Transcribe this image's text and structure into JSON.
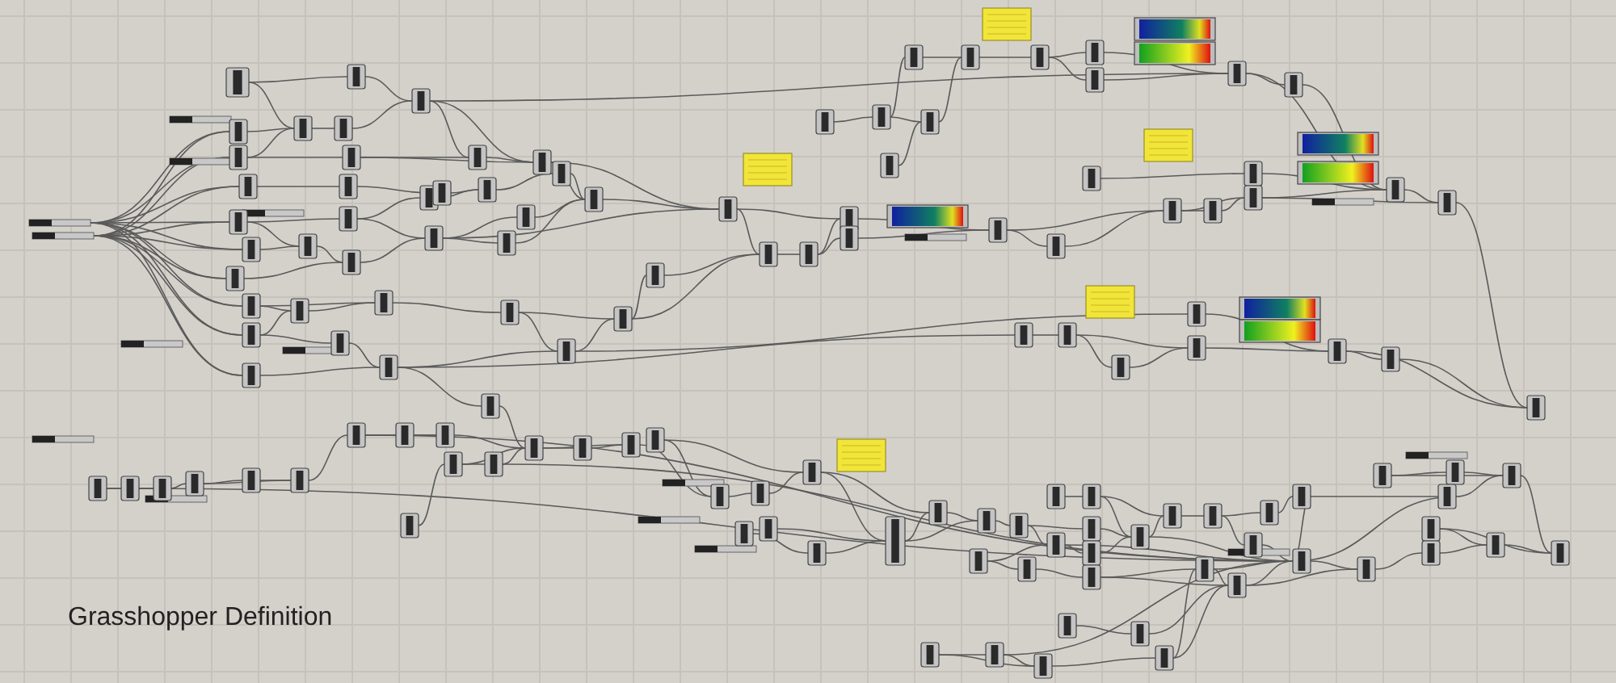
{
  "canvas": {
    "caption": "Grasshopper Definition"
  }
}
